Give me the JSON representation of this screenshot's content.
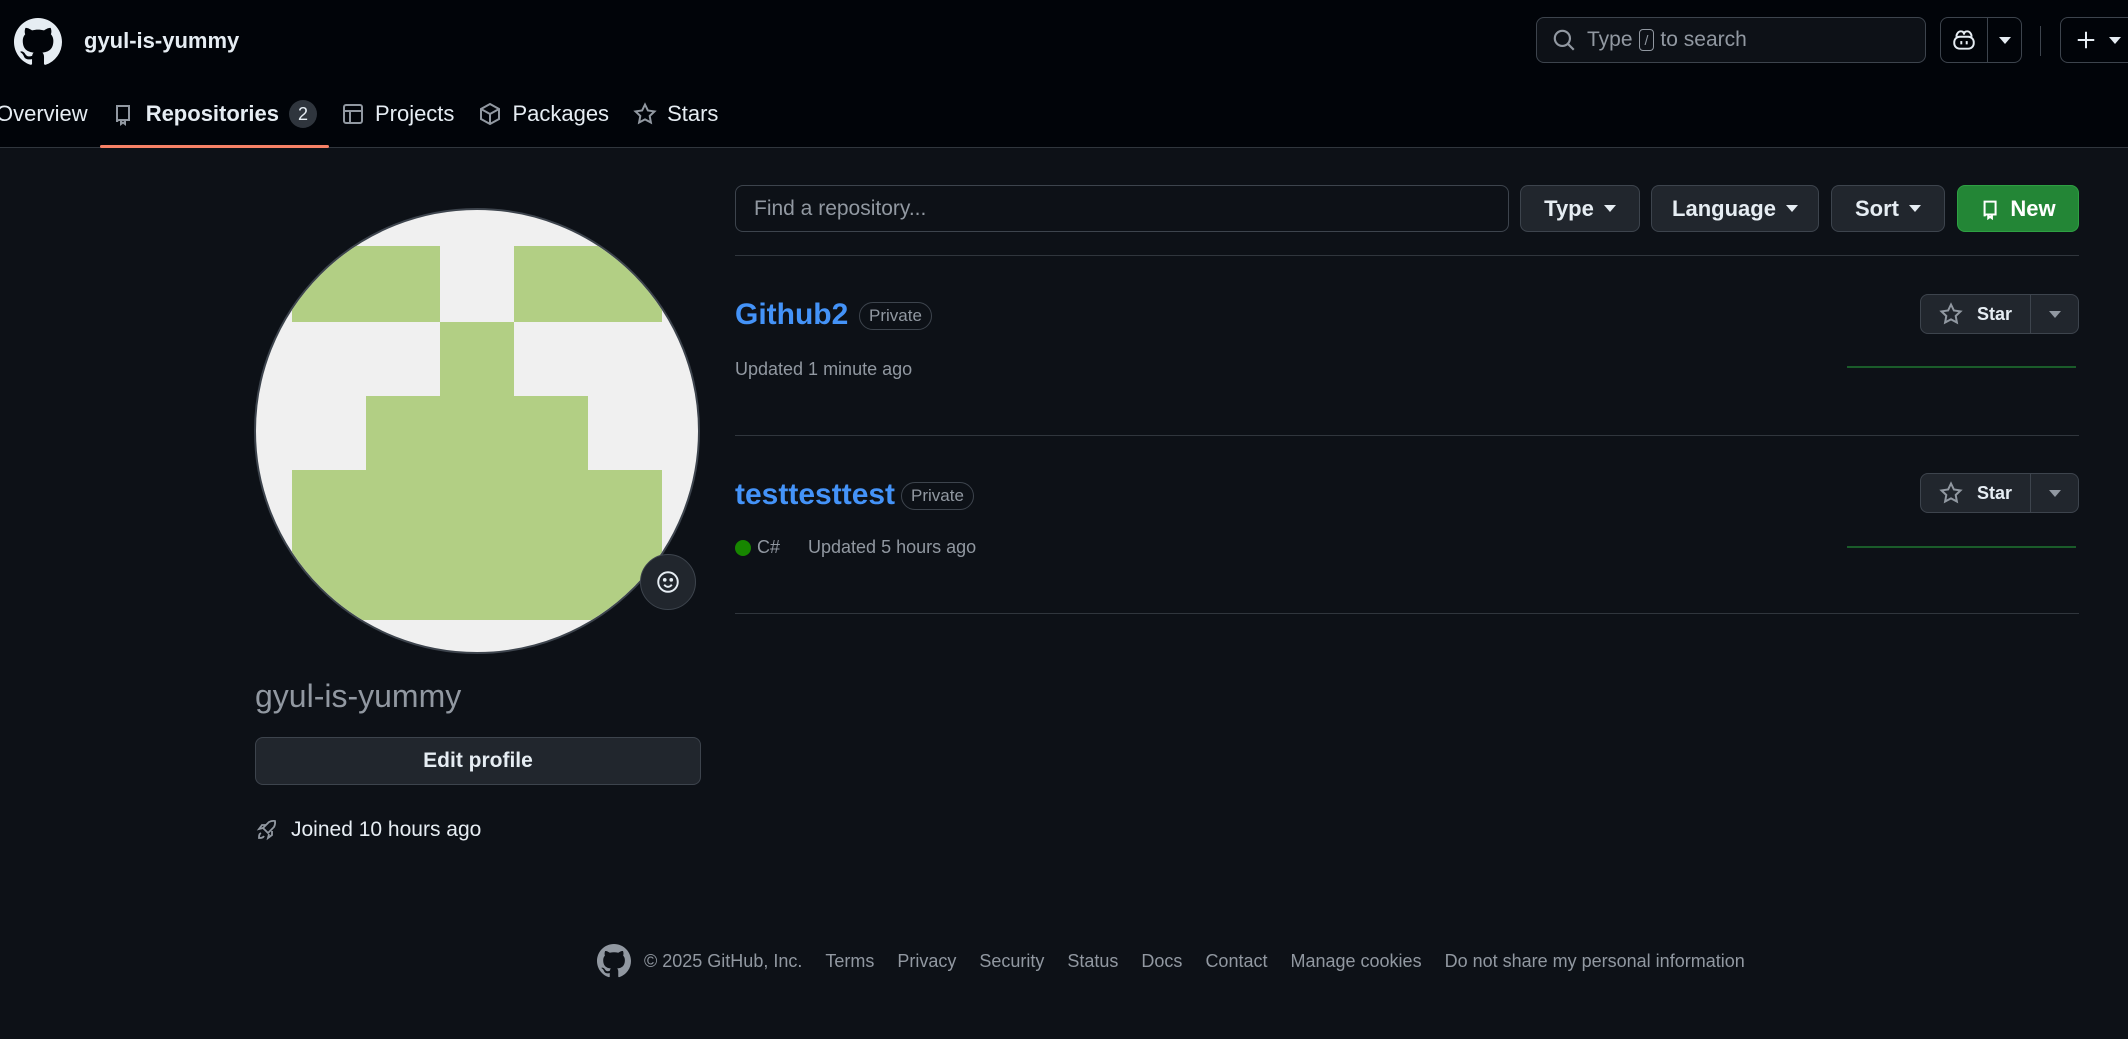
{
  "header": {
    "username": "gyul-is-yummy",
    "search": {
      "prefix": "Type",
      "key": "/",
      "suffix": "to search"
    }
  },
  "tabs": [
    {
      "label": "Overview",
      "icon": "book-open-icon"
    },
    {
      "label": "Repositories",
      "icon": "repo-icon",
      "count": "2",
      "active": true
    },
    {
      "label": "Projects",
      "icon": "table-icon"
    },
    {
      "label": "Packages",
      "icon": "package-icon"
    },
    {
      "label": "Stars",
      "icon": "star-icon"
    }
  ],
  "profile": {
    "name": "gyul-is-yummy",
    "edit_label": "Edit profile",
    "joined": "Joined 10 hours ago"
  },
  "filters": {
    "find_placeholder": "Find a repository...",
    "type_label": "Type",
    "language_label": "Language",
    "sort_label": "Sort",
    "new_label": "New"
  },
  "repos": [
    {
      "name": "Github2",
      "visibility": "Private",
      "language": "",
      "updated": "Updated 1 minute ago",
      "star_label": "Star"
    },
    {
      "name": "testtesttest",
      "visibility": "Private",
      "language": "C#",
      "updated": "Updated 5 hours ago",
      "star_label": "Star"
    }
  ],
  "footer": {
    "copyright": "© 2025 GitHub, Inc.",
    "links": [
      "Terms",
      "Privacy",
      "Security",
      "Status",
      "Docs",
      "Contact",
      "Manage cookies",
      "Do not share my personal information"
    ]
  },
  "colors": {
    "accent_link": "#4493f8",
    "tab_underline": "#f78166",
    "new_button": "#238636",
    "csharp": "#178600",
    "avatar_green": "#b2cf84"
  }
}
